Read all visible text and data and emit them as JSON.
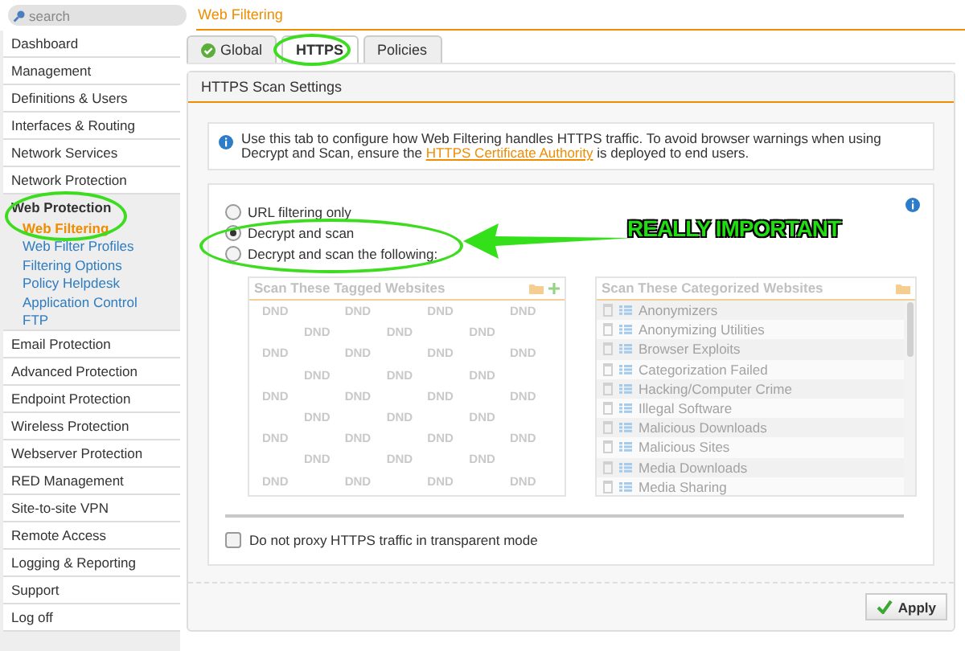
{
  "search": {
    "placeholder": "search"
  },
  "page_title": "Web Filtering",
  "sidebar": {
    "items": [
      {
        "label": "Dashboard",
        "expanded": false
      },
      {
        "label": "Management",
        "expanded": false
      },
      {
        "label": "Definitions & Users",
        "expanded": false
      },
      {
        "label": "Interfaces & Routing",
        "expanded": false
      },
      {
        "label": "Network Services",
        "expanded": false
      },
      {
        "label": "Network Protection",
        "expanded": false
      },
      {
        "label": "Web Protection",
        "expanded": true,
        "children": [
          {
            "label": "Web Filtering",
            "selected": true
          },
          {
            "label": "Web Filter Profiles",
            "selected": false
          },
          {
            "label": "Filtering Options",
            "selected": false
          },
          {
            "label": "Policy Helpdesk",
            "selected": false
          },
          {
            "label": "Application Control",
            "selected": false
          },
          {
            "label": "FTP",
            "selected": false
          }
        ]
      },
      {
        "label": "Email Protection",
        "expanded": false
      },
      {
        "label": "Advanced Protection",
        "expanded": false
      },
      {
        "label": "Endpoint Protection",
        "expanded": false
      },
      {
        "label": "Wireless Protection",
        "expanded": false
      },
      {
        "label": "Webserver Protection",
        "expanded": false
      },
      {
        "label": "RED Management",
        "expanded": false
      },
      {
        "label": "Site-to-site VPN",
        "expanded": false
      },
      {
        "label": "Remote Access",
        "expanded": false
      },
      {
        "label": "Logging & Reporting",
        "expanded": false
      },
      {
        "label": "Support",
        "expanded": false
      },
      {
        "label": "Log off",
        "expanded": false
      }
    ]
  },
  "tabs": [
    {
      "label": "Global",
      "selected": false,
      "status_ok": true
    },
    {
      "label": "HTTPS",
      "selected": true,
      "status_ok": false
    },
    {
      "label": "Policies",
      "selected": false,
      "status_ok": false
    }
  ],
  "panel": {
    "title": "HTTPS Scan Settings",
    "info": {
      "before": "Use this tab to configure how Web Filtering handles HTTPS traffic. To avoid browser warnings when using Decrypt and Scan, ensure the ",
      "link": "HTTPS Certificate Authority",
      "after": " is deployed to end users."
    },
    "options": [
      {
        "label": "URL filtering only",
        "selected": false
      },
      {
        "label": "Decrypt and scan",
        "selected": true
      },
      {
        "label": "Decrypt and scan the following:",
        "selected": false
      }
    ],
    "tagged_list": {
      "title": "Scan These Tagged Websites",
      "disabled": true,
      "dnd_rows": [
        "DND DND DND DND",
        "DND DND DND",
        "DND DND DND DND",
        "DND DND DND",
        "DND DND DND DND",
        "DND DND DND",
        "DND DND DND DND",
        "DND DND DND",
        "DND DND DND DND"
      ]
    },
    "category_list": {
      "title": "Scan These Categorized Websites",
      "disabled": true,
      "items": [
        "Anonymizers",
        "Anonymizing Utilities",
        "Browser Exploits",
        "Categorization Failed",
        "Hacking/Computer Crime",
        "Illegal Software",
        "Malicious Downloads",
        "Malicious Sites",
        "Media Downloads",
        "Media Sharing"
      ]
    },
    "transparent_checkbox": {
      "label": "Do not proxy HTTPS traffic in transparent mode",
      "checked": false
    },
    "apply_button": "Apply"
  },
  "annotation": {
    "label": "REALLY IMPORTANT"
  }
}
